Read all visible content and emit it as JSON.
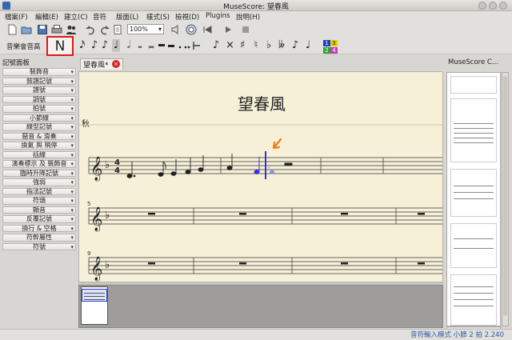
{
  "window": {
    "title": "MuseScore: 望春風"
  },
  "menu": [
    "檔案(F)",
    "編輯(E)",
    "建立(C)",
    "音符",
    "版面(L)",
    "樣式(S)",
    "檢視(D)",
    "Plugins",
    "說明(H)"
  ],
  "toolbar": {
    "zoom_value": "100%"
  },
  "note_input": {
    "label": "音樂會音高",
    "button_label": "N"
  },
  "durations": [
    "𝅘𝅥𝅯",
    "♪",
    "♪",
    "♩",
    "𝅗𝅥",
    "𝅝",
    "𝅜"
  ],
  "accidentals": [
    "×",
    "♯",
    "♮",
    "♭",
    "𝄫"
  ],
  "voices": [
    {
      "label": "1",
      "color": "#1a3fd6"
    },
    {
      "label": "3",
      "color": "#e6d200"
    },
    {
      "label": "2",
      "color": "#2aa82a"
    },
    {
      "label": "4",
      "color": "#c43ac4"
    }
  ],
  "palette": {
    "title": "記號面板",
    "items": [
      "裝飾音",
      "鼓譜記號",
      "譜號",
      "調號",
      "拍號",
      "小節線",
      "線型記號",
      "琶音 & 滑奏",
      "換氣 與 稍停",
      "括線",
      "演奏標示 及 裝飾音",
      "臨時升降記號",
      "強弱",
      "指法記號",
      "符頭",
      "顫音",
      "反覆記號",
      "換行 & 空格",
      "符幹屬性",
      "符號"
    ]
  },
  "score": {
    "tab_label": "望春風*",
    "title": "望春風",
    "composer_text": "秋",
    "measure_numbers": [
      "5",
      "9"
    ],
    "time_signature": "4/4"
  },
  "right_panel": {
    "title": "MuseScore C..."
  },
  "status": {
    "text": "音符輸入模式 小節 2 拍 2.240"
  },
  "colors": {
    "accent_blue": "#2a5aa8",
    "highlight_red": "#e01818",
    "cursor_blue": "#3030e0",
    "arrow_orange": "#f07a10",
    "paper": "#f6f0d8"
  }
}
